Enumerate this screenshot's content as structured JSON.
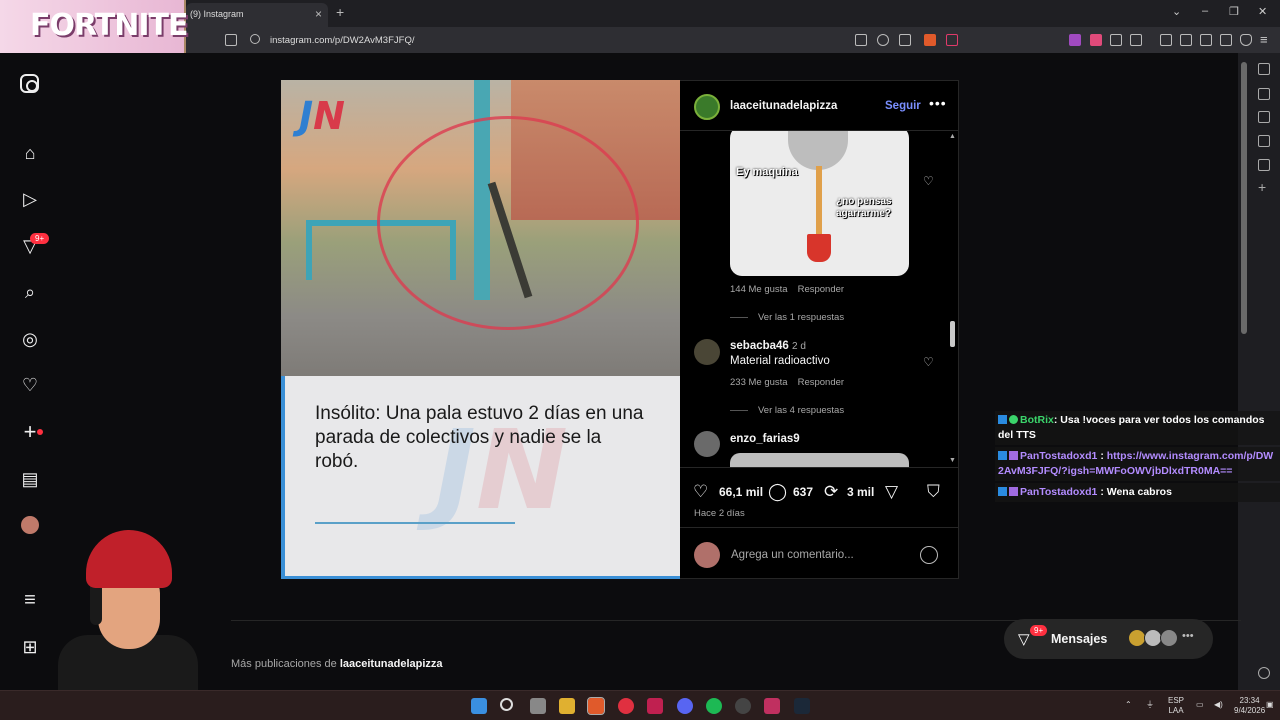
{
  "browser": {
    "tab_title": "(9) Instagram",
    "url": "instagram.com/p/DW2AvM3FJFQ/",
    "overlay_logo": "FORTNITE"
  },
  "ig_nav": {
    "icons": [
      "instagram-logo-icon",
      "home-icon",
      "reels-icon",
      "direct-icon",
      "search-icon",
      "explore-icon",
      "notifications-icon",
      "create-icon",
      "dashboard-icon",
      "profile-avatar",
      "menu-icon",
      "apps-icon"
    ],
    "direct_badge": "9+"
  },
  "post": {
    "image_logo": "JN",
    "caption": "Insólito: Una pala estuvo 2 días en una parada de colectivos y nadie se la robó.",
    "author": "laaceitunadelapizza",
    "follow_label": "Seguir",
    "more_label": "•••",
    "time_ago": "Hace 2 días",
    "comment_placeholder": "Agrega un comentario...",
    "counts": {
      "likes": "66,1 mil",
      "comments": "637",
      "reposts": "3 mil"
    }
  },
  "comments": [
    {
      "sticker_text_1": "Ey maquina",
      "sticker_text_2": "¿no pensas agarrarme?",
      "likes": "144 Me gusta",
      "reply_label": "Responder",
      "view_replies": "Ver las 1 respuestas"
    },
    {
      "user": "sebacba46",
      "time": "2 d",
      "text": "Material radioactivo",
      "likes": "233 Me gusta",
      "reply_label": "Responder",
      "view_replies": "Ver las 4 respuestas"
    },
    {
      "user": "enzo_farias9"
    }
  ],
  "more_posts": {
    "prefix": "Más publicaciones de ",
    "user": "laaceitunadelapizza"
  },
  "messages": {
    "label": "Mensajes",
    "badge": "9+"
  },
  "chat": [
    {
      "user": "BotRix",
      "sep": ": ",
      "text": "Usa !voces para ver todos los comandos del TTS"
    },
    {
      "user": "PanTostadoxd1",
      "sep": " : ",
      "text": "https://www.instagram.com/p/DW2AvM3FJFQ/?igsh=MWFoOWVjbDlxdTR0MA=="
    },
    {
      "user": "PanTostadoxd1",
      "sep": " : ",
      "text": "Wena cabros"
    }
  ],
  "taskbar": {
    "lang": "ESP",
    "region": "LAA",
    "time": "23:34",
    "date": "9/4/2026"
  },
  "colors": {
    "accent_link": "#7a8fff",
    "badge_red": "#ff3040",
    "chat_green": "#3bd46b",
    "chat_purple": "#b38cff"
  }
}
